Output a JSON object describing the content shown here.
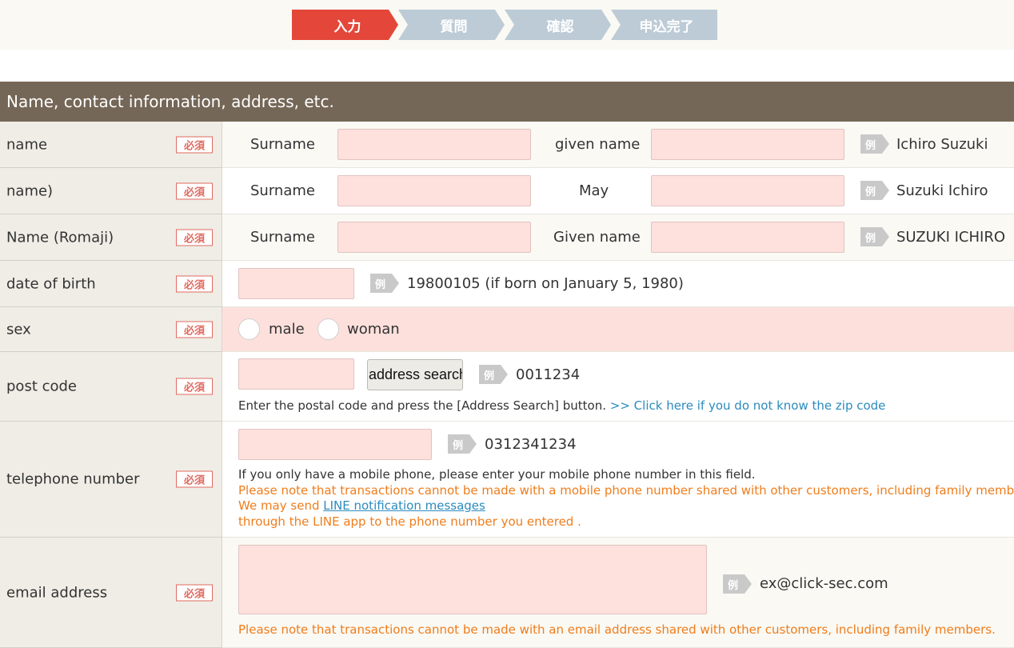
{
  "steps": [
    "入力",
    "質問",
    "確認",
    "申込完了"
  ],
  "section_title": "Name, contact information, address, etc.",
  "required_label": "必須",
  "example_label": "例",
  "rows": {
    "name": {
      "label": "name",
      "surname_label": "Surname",
      "given_label": "given name",
      "example": "Ichiro Suzuki"
    },
    "kana": {
      "label": "name)",
      "surname_label": "Surname",
      "given_label": "May",
      "example": "Suzuki Ichiro"
    },
    "romaji": {
      "label": "Name (Romaji)",
      "surname_label": "Surname",
      "given_label": "Given name",
      "example": "SUZUKI ICHIRO"
    },
    "dob": {
      "label": "date of birth",
      "example": "19800105 (if born on January 5, 1980)"
    },
    "sex": {
      "label": "sex",
      "option_male": "male",
      "option_female": "woman"
    },
    "postcode": {
      "label": "post code",
      "button": "address search",
      "example": "0011234",
      "note": "Enter the postal code and press the [Address Search] button.",
      "link": ">> Click here if you do not know the zip code"
    },
    "phone": {
      "label": "telephone number",
      "example": "0312341234",
      "note1": "If you only have a mobile phone, please enter your mobile phone number in this field.",
      "note2": "Please note that transactions cannot be made with a mobile phone number shared with other customers, including family members.",
      "note3_prefix": "We may send ",
      "note3_link": "LINE notification messages",
      "note4": "through the LINE app to the phone number you entered ."
    },
    "email": {
      "label": "email address",
      "example": "ex@click-sec.com",
      "note": "Please note that transactions cannot be made with an email address shared with other customers, including family members."
    }
  }
}
